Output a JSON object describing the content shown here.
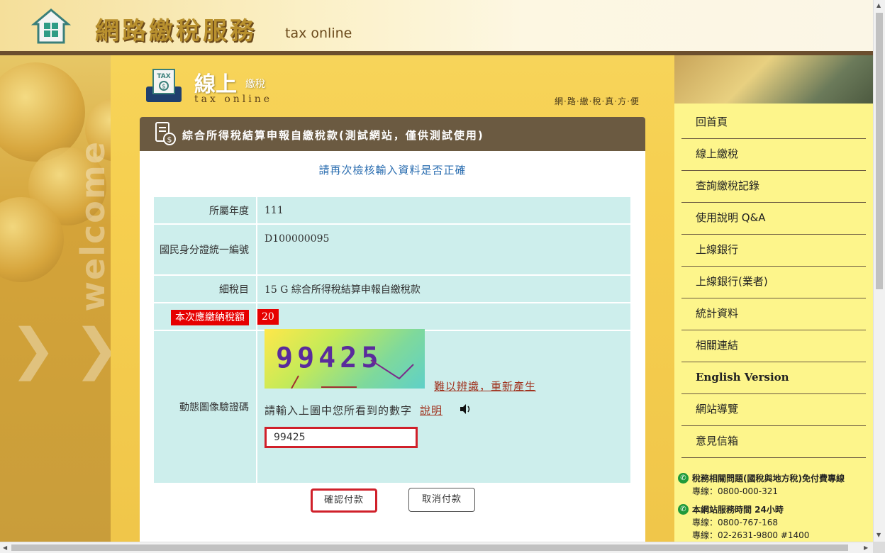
{
  "header": {
    "title": "網路繳稅服務",
    "subtitle": "tax online"
  },
  "left": {
    "welcome": "welcome"
  },
  "banner": {
    "title": "線上",
    "title_small": "繳稅",
    "subtitle": "tax online",
    "slogan": "網·路·繳·稅·真·方·便",
    "icon_label": "TAX"
  },
  "panel": {
    "title": "綜合所得稅結算申報自繳稅款(測試網站，僅供測試使用)",
    "notice": "請再次檢核輸入資料是否正確"
  },
  "fields": [
    {
      "label": "所屬年度",
      "value": "111"
    },
    {
      "label": "國民身分證統一編號",
      "value": "D100000095"
    },
    {
      "label": "細稅目",
      "value": "15 G 綜合所得稅結算申報自繳稅款"
    },
    {
      "label": "本次應繳納稅額",
      "value": "20"
    },
    {
      "label": "動態圖像驗證碼"
    }
  ],
  "captcha": {
    "image_text": "99425",
    "regenerate_link": "難以辨識，重新產生",
    "hint": "請輸入上圖中您所看到的數字",
    "explain_link": "說明",
    "input_value": "99425"
  },
  "buttons": {
    "confirm": "確認付款",
    "cancel": "取消付款"
  },
  "menu": [
    "回首頁",
    "線上繳稅",
    "查詢繳稅記錄",
    "使用說明 Q&A",
    "上線銀行",
    "上線銀行(業者)",
    "統計資料",
    "相關連結",
    "English Version",
    "網站導覽",
    "意見信箱"
  ],
  "contact": [
    {
      "title": "稅務相關問題(國稅與地方稅)免付費專線",
      "lines": [
        "專線：0800-000-321"
      ]
    },
    {
      "title": "本網站服務時間 24小時",
      "lines": [
        "專線：0800-767-168",
        "專線：02-2631-9800 #1400"
      ]
    }
  ],
  "colors": {
    "panel_header": "#6b5a41",
    "table_cell": "#cdeeec",
    "highlight_red": "#e60000",
    "link": "#a0321e",
    "notice_blue": "#2a6db0",
    "menu_bg": "#fdf58b"
  }
}
